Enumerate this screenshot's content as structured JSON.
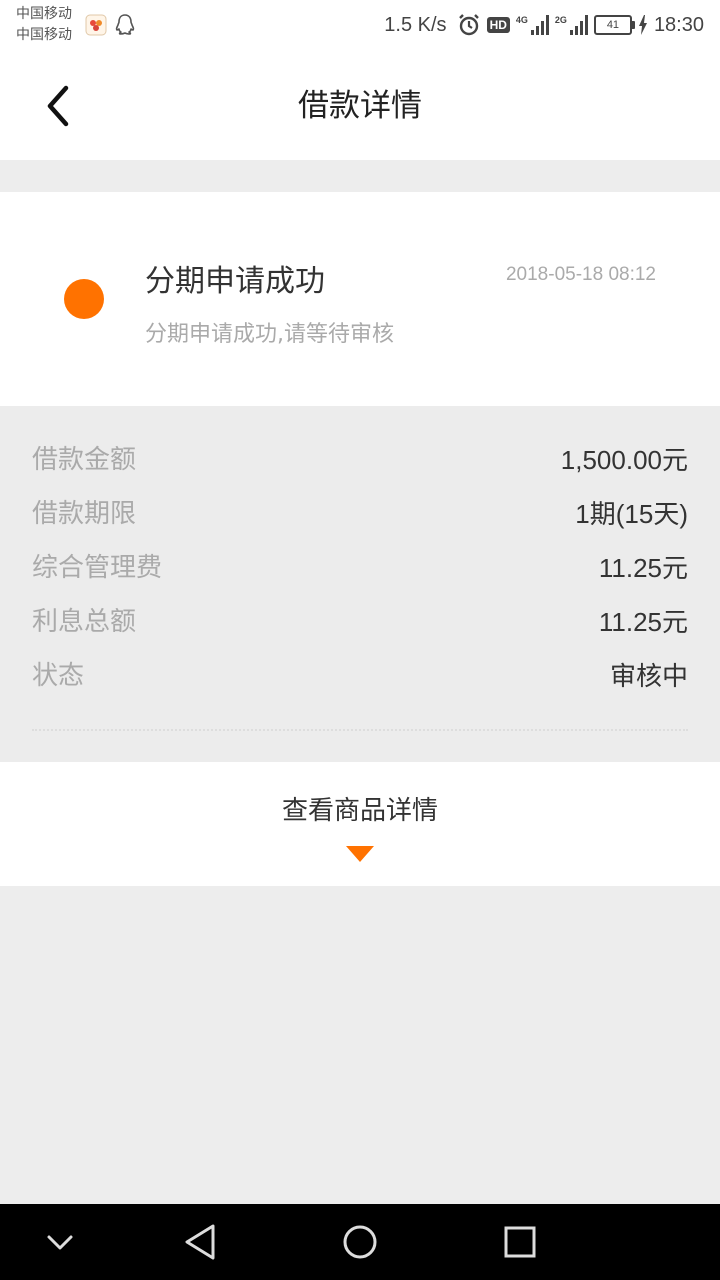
{
  "status_bar": {
    "carrier_line1": "中国移动",
    "carrier_line2": "中国移动",
    "net_speed": "1.5 K/s",
    "hd_badge": "HD",
    "net1_label": "4G",
    "net2_label": "2G",
    "battery_level": "41",
    "time": "18:30"
  },
  "header": {
    "title": "借款详情"
  },
  "status_card": {
    "title": "分期申请成功",
    "timestamp": "2018-05-18  08:12",
    "description": "分期申请成功,请等待审核",
    "dot_color": "#ff7200"
  },
  "details": {
    "rows": [
      {
        "label": "借款金额",
        "value": "1,500.00元"
      },
      {
        "label": "借款期限",
        "value": "1期(15天)"
      },
      {
        "label": "综合管理费",
        "value": "11.25元"
      },
      {
        "label": "利息总额",
        "value": "11.25元"
      },
      {
        "label": "状态",
        "value": "审核中"
      }
    ]
  },
  "product_toggle": {
    "label": "查看商品详情"
  },
  "colors": {
    "accent": "#ff7200",
    "page_background": "#ededed"
  },
  "icons": {
    "back": "chevron-left-icon",
    "expand": "triangle-down-icon",
    "nav_hide": "chevron-down-icon",
    "nav_back": "triangle-back-icon",
    "nav_home": "circle-home-icon",
    "nav_recents": "square-recents-icon"
  }
}
